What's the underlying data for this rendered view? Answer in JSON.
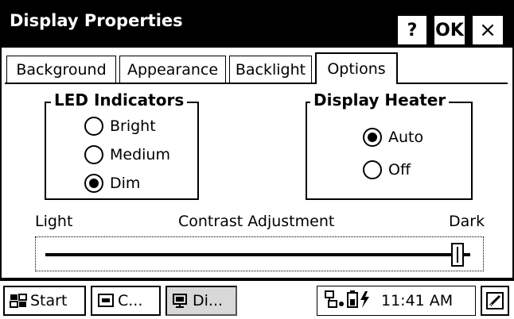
{
  "window": {
    "title": "Display Properties",
    "help_label": "?",
    "ok_label": "OK",
    "close_label": "×"
  },
  "tabs": [
    {
      "label": "Background",
      "active": false
    },
    {
      "label": "Appearance",
      "active": false
    },
    {
      "label": "Backlight",
      "active": false
    },
    {
      "label": "Options",
      "active": true
    }
  ],
  "led_indicators": {
    "title": "LED Indicators",
    "options": [
      {
        "label": "Bright",
        "checked": false
      },
      {
        "label": "Medium",
        "checked": false
      },
      {
        "label": "Dim",
        "checked": true
      }
    ]
  },
  "display_heater": {
    "title": "Display Heater",
    "options": [
      {
        "label": "Auto",
        "checked": true
      },
      {
        "label": "Off",
        "checked": false
      }
    ]
  },
  "contrast": {
    "label": "Contrast Adjustment",
    "min_label": "Light",
    "max_label": "Dark",
    "value_fraction": 0.97
  },
  "taskbar": {
    "start_label": "Start",
    "task1_label": "C...",
    "task2_label": "Di...",
    "clock": "11:41 AM"
  }
}
